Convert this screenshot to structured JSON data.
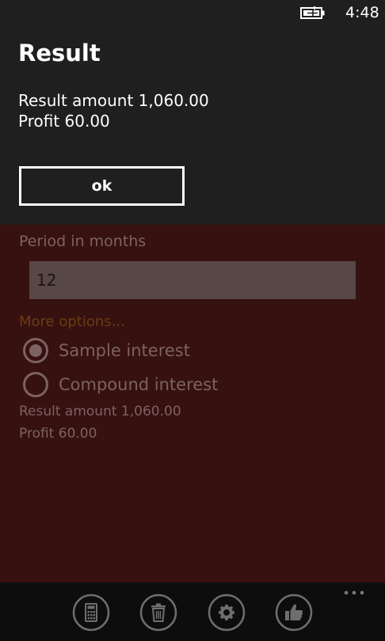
{
  "status_bar": {
    "time": "4:48",
    "battery_icon": "battery-charging-icon"
  },
  "dialog": {
    "title": "Result",
    "lines": [
      "Result amount 1,060.00",
      "Profit 60.00"
    ],
    "ok_label": "ok"
  },
  "page": {
    "period_label": "Period in months",
    "period_value": "12",
    "more_options": "More options...",
    "radio_options": [
      {
        "label": "Sample interest",
        "selected": true
      },
      {
        "label": "Compound interest",
        "selected": false
      }
    ],
    "result_line": "Result amount 1,060.00",
    "profit_line": "Profit 60.00"
  },
  "app_bar": {
    "buttons": [
      {
        "icon": "calculator-icon"
      },
      {
        "icon": "trash-icon"
      },
      {
        "icon": "gear-icon"
      },
      {
        "icon": "thumbs-up-icon"
      }
    ],
    "more_icon": "more-dots-icon"
  },
  "colors": {
    "chrome": "#1f1f1f",
    "page_background": "#371010",
    "accent_dimmed": "#6a3d10",
    "app_bar": "#0d0d0d"
  }
}
